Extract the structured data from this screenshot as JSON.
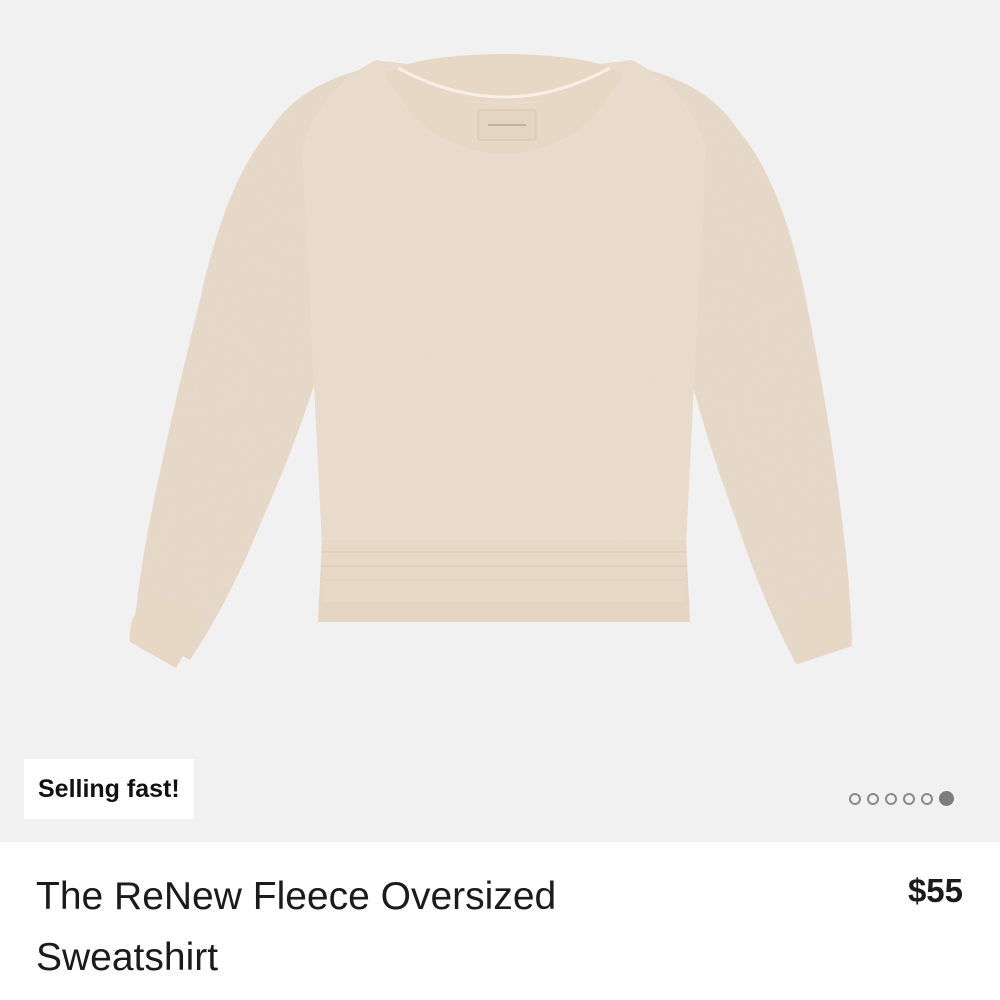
{
  "product": {
    "badge": "Selling fast!",
    "title": "The ReNew Fleece Oversized Sweatshirt",
    "price": "$55",
    "image_icon": "sweatshirt-image",
    "carousel": {
      "total": 6,
      "active_index": 6
    }
  },
  "colors": {
    "image_background": "#f1f1f1",
    "garment": "#e9dccb",
    "text": "#1b1b1b",
    "dot": "#7d7d7d"
  }
}
